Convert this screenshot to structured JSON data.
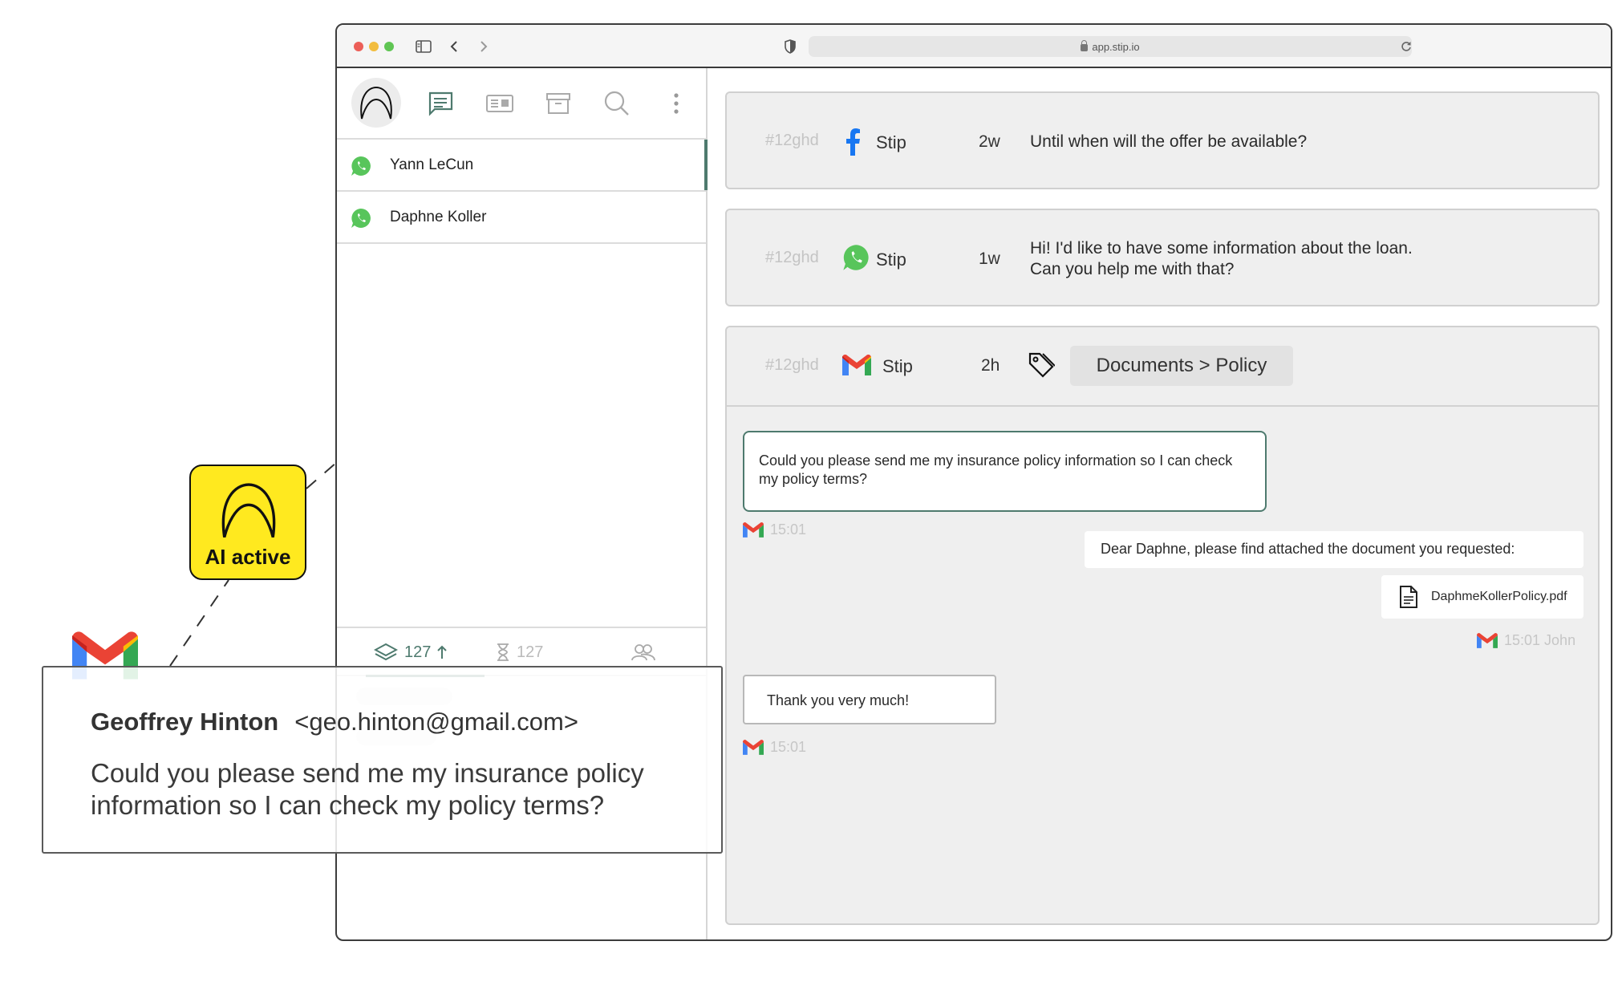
{
  "browser": {
    "url": "app.stip.io"
  },
  "sidebar": {
    "contacts": [
      {
        "name": "Yann LeCun",
        "channel": "whatsapp"
      },
      {
        "name": "Daphne Koller",
        "channel": "whatsapp"
      }
    ],
    "footer": {
      "inbox_count": "127",
      "pending_count": "127"
    },
    "icons": [
      "stip-logo-icon",
      "chat-icon",
      "contact-card-icon",
      "archive-icon",
      "search-icon",
      "more-vertical-icon"
    ]
  },
  "conversations": [
    {
      "ticket": "#12ghd",
      "channel": "facebook",
      "account": "Stip",
      "age": "2w",
      "message": "Until when will the offer be available?"
    },
    {
      "ticket": "#12ghd",
      "channel": "whatsapp",
      "account": "Stip",
      "age": "1w",
      "message_line1": "Hi! I'd like to have some information about the loan.",
      "message_line2": "Can you help me with that?"
    },
    {
      "ticket": "#12ghd",
      "channel": "gmail",
      "account": "Stip",
      "age": "2h",
      "tag": "Documents > Policy"
    }
  ],
  "thread": {
    "incoming1": "Could you please send me my insurance policy information so I can check my policy terms?",
    "incoming1_time": "15:01",
    "outgoing1": "Dear Daphne, please find attached the document you requested:",
    "attachment": "DaphmeKollerPolicy.pdf",
    "outgoing_time": "15:01 John",
    "incoming2": "Thank you very much!",
    "incoming2_time": "15:01"
  },
  "ai_badge": {
    "label": "AI active"
  },
  "email_preview": {
    "sender_name": "Geoffrey Hinton",
    "sender_email": "<geo.hinton@gmail.com>",
    "body": "Could you please send me my insurance policy information so I can check my policy terms?"
  },
  "colors": {
    "accent": "#4e7a6e",
    "whatsapp": "#58c55b",
    "facebook": "#1877f2",
    "ai_yellow": "#ffe91f"
  }
}
